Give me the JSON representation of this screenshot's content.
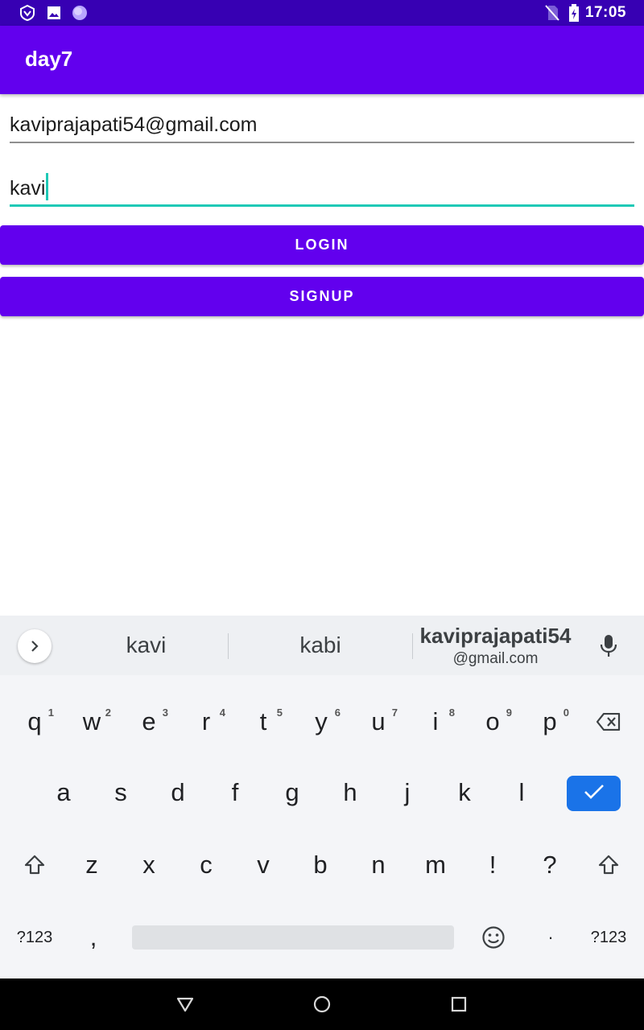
{
  "status_bar": {
    "time": "17:05",
    "icons": [
      "shield-notification-icon",
      "image-notification-icon",
      "circle-notification-icon",
      "no-sim-icon",
      "battery-charging-icon"
    ]
  },
  "app_bar": {
    "title": "day7"
  },
  "form": {
    "email_value": "kaviprajapati54@gmail.com",
    "password_value": "kavi",
    "login_label": "LOGIN",
    "signup_label": "SIGNUP"
  },
  "keyboard": {
    "suggestions": {
      "first": "kavi",
      "second": "kabi",
      "third_main": "kaviprajapati54",
      "third_sub": "@gmail.com"
    },
    "rows": [
      [
        {
          "k": "q",
          "h": "1"
        },
        {
          "k": "w",
          "h": "2"
        },
        {
          "k": "e",
          "h": "3"
        },
        {
          "k": "r",
          "h": "4"
        },
        {
          "k": "t",
          "h": "5"
        },
        {
          "k": "y",
          "h": "6"
        },
        {
          "k": "u",
          "h": "7"
        },
        {
          "k": "i",
          "h": "8"
        },
        {
          "k": "o",
          "h": "9"
        },
        {
          "k": "p",
          "h": "0"
        }
      ],
      [
        {
          "k": "a"
        },
        {
          "k": "s"
        },
        {
          "k": "d"
        },
        {
          "k": "f"
        },
        {
          "k": "g"
        },
        {
          "k": "h"
        },
        {
          "k": "j"
        },
        {
          "k": "k"
        },
        {
          "k": "l"
        }
      ],
      [
        {
          "k": "z"
        },
        {
          "k": "x"
        },
        {
          "k": "c"
        },
        {
          "k": "v"
        },
        {
          "k": "b"
        },
        {
          "k": "n"
        },
        {
          "k": "m"
        },
        {
          "k": "!"
        },
        {
          "k": "?"
        }
      ]
    ],
    "symbols_label": "?123",
    "comma": ",",
    "period": "·",
    "icons": [
      "chevron-right-icon",
      "microphone-icon",
      "backspace-icon",
      "check-icon",
      "shift-icon",
      "emoji-icon"
    ]
  },
  "nav_bar": {
    "icons": [
      "back-triangle-icon",
      "home-circle-icon",
      "recents-square-icon"
    ]
  },
  "colors": {
    "primary": "#6200ee",
    "primary_dark": "#3700b3",
    "accent": "#1fc9b6",
    "enter_key": "#1a73e8"
  }
}
